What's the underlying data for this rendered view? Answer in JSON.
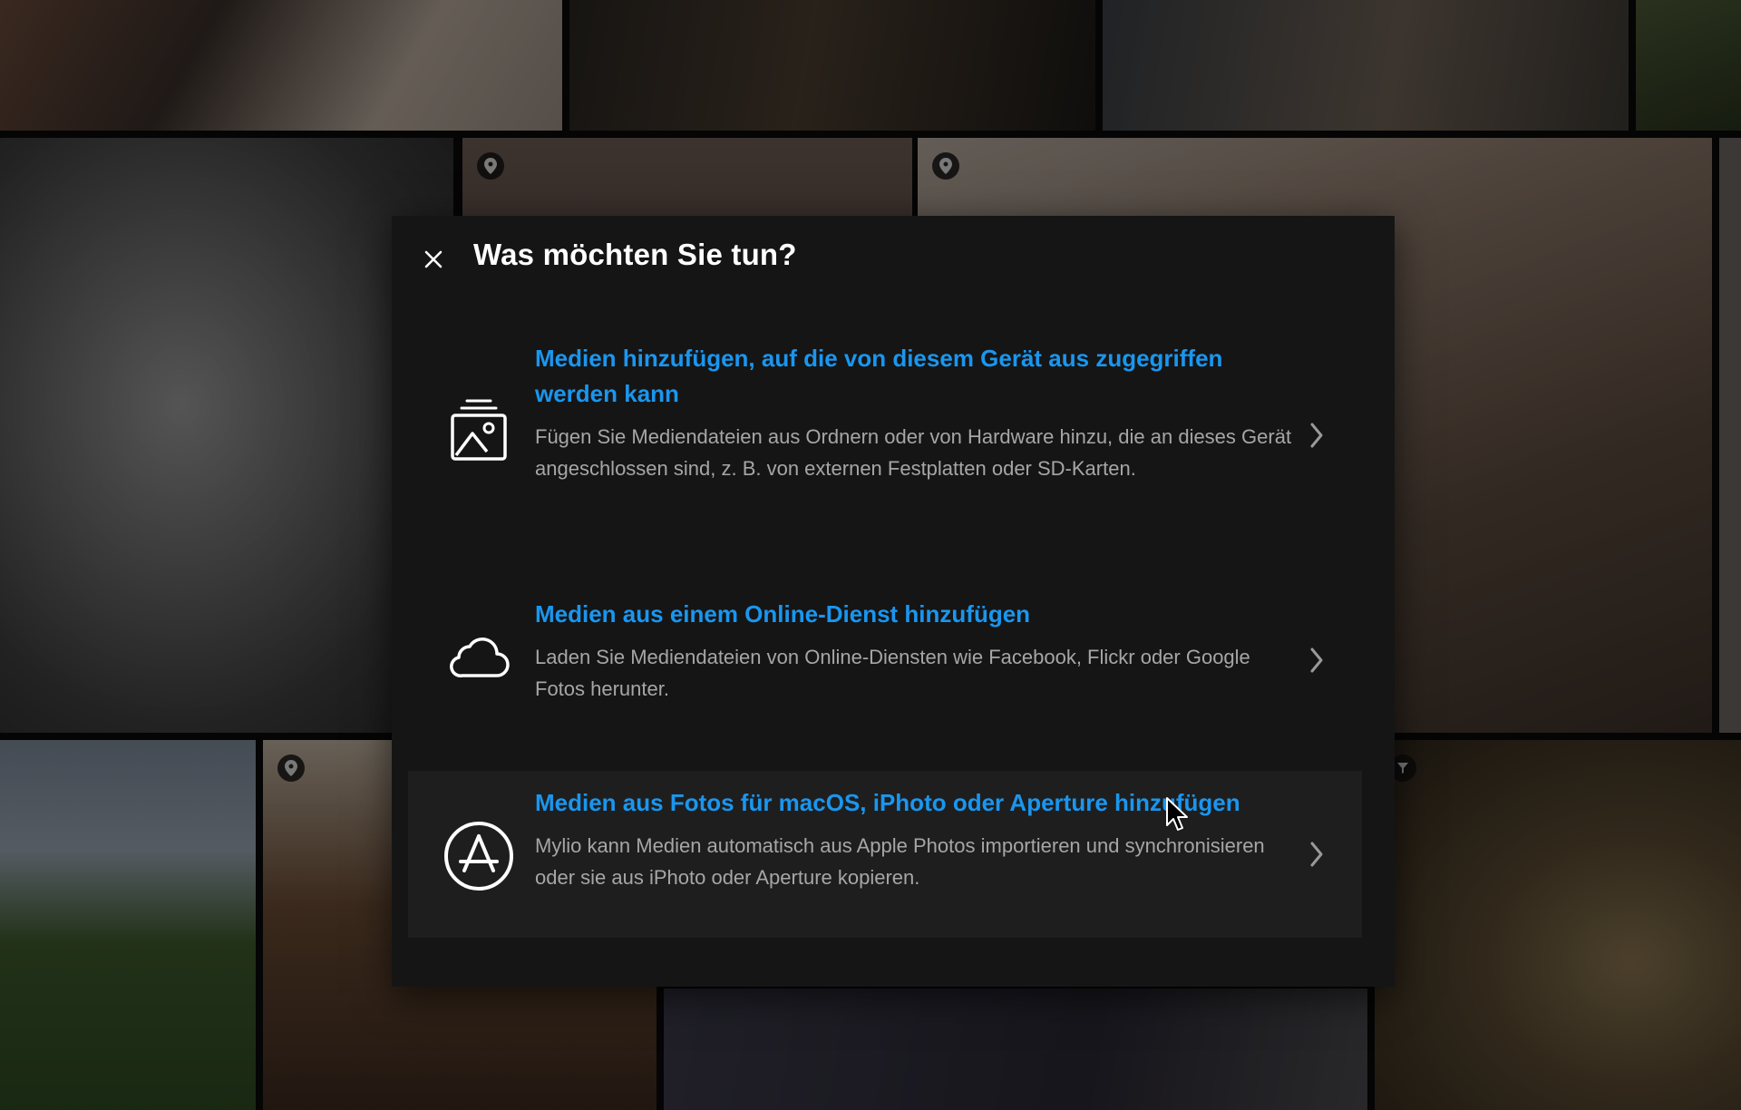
{
  "background": {
    "tiles": [
      "photo-dog-backpack",
      "photo-dog-dark",
      "photo-dog-lawn",
      "photo-grass",
      "photo-dog-sleeping-bw",
      "photo-dog-couch",
      "photo-cat-chair",
      "photo-strip",
      "photo-beach-dog",
      "photo-dog-bowtie",
      "photo-dog-laptop",
      "photo-cat-closeup"
    ]
  },
  "dialog": {
    "title": "Was möchten Sie tun?",
    "close_icon": "close-icon",
    "options": [
      {
        "icon": "media-stack-icon",
        "title": "Medien hinzufügen, auf die von diesem Gerät aus zugegriffen werden kann",
        "description": "Fügen Sie Mediendateien aus Ordnern oder von Hardware hinzu, die an dieses Gerät angeschlossen sind, z. B. von externen Festplatten oder SD-Karten."
      },
      {
        "icon": "cloud-icon",
        "title": "Medien aus einem Online-Dienst hinzufügen",
        "description": "Laden Sie Mediendateien von Online-Diensten wie Facebook, Flickr oder Google Fotos herunter."
      },
      {
        "icon": "app-store-icon",
        "title": "Medien aus Fotos für macOS, iPhoto oder Aperture hinzufügen",
        "description": "Mylio kann Medien automatisch aus Apple Photos importieren und synchronisieren oder sie aus iPhoto oder Aperture kopieren."
      }
    ]
  },
  "colors": {
    "accent": "#1a96ef",
    "dialog_bg": "#151515",
    "hover_bg": "#1e1e1e",
    "text_muted": "#a6a6a6"
  }
}
